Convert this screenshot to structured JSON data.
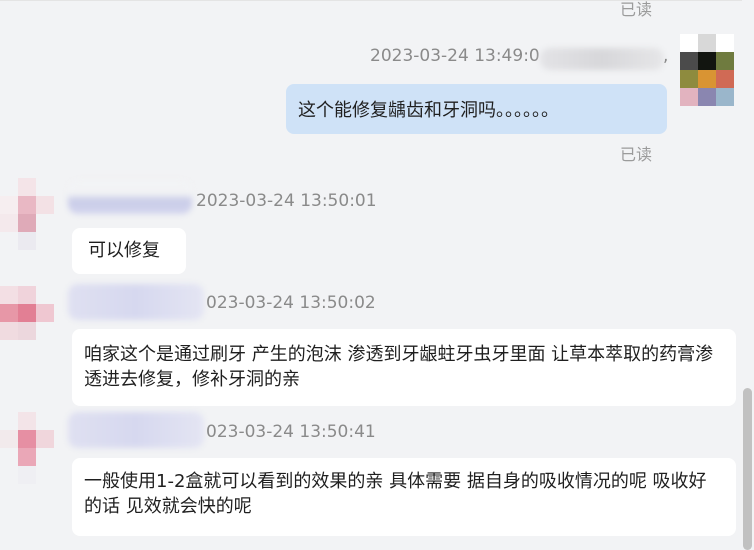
{
  "chat": {
    "top_read": "已读",
    "outgoing": {
      "timestamp": "2023-03-24 13:49:0",
      "text": "这个能修复龋齿和牙洞吗。。。。。。",
      "read": "已读"
    },
    "messages": [
      {
        "timestamp": "2023-03-24 13:50:01",
        "text": "可以修复"
      },
      {
        "timestamp": "023-03-24 13:50:02",
        "text": "咱家这个是通过刷牙 产生的泡沫 渗透到牙龈蛀牙虫牙里面 让草本萃取的药膏渗透进去修复，修补牙洞的亲"
      },
      {
        "timestamp": "023-03-24 13:50:41",
        "text": "一般使用1-2盒就可以看到的效果的亲 具体需要 据自身的吸收情况的呢 吸收好的话 见效就会快的呢"
      }
    ]
  },
  "colors": {
    "background": "#f2f3f5",
    "outgoing_bubble": "#cfe2f7",
    "incoming_bubble": "#ffffff",
    "read_text": "#9b9b9b"
  }
}
